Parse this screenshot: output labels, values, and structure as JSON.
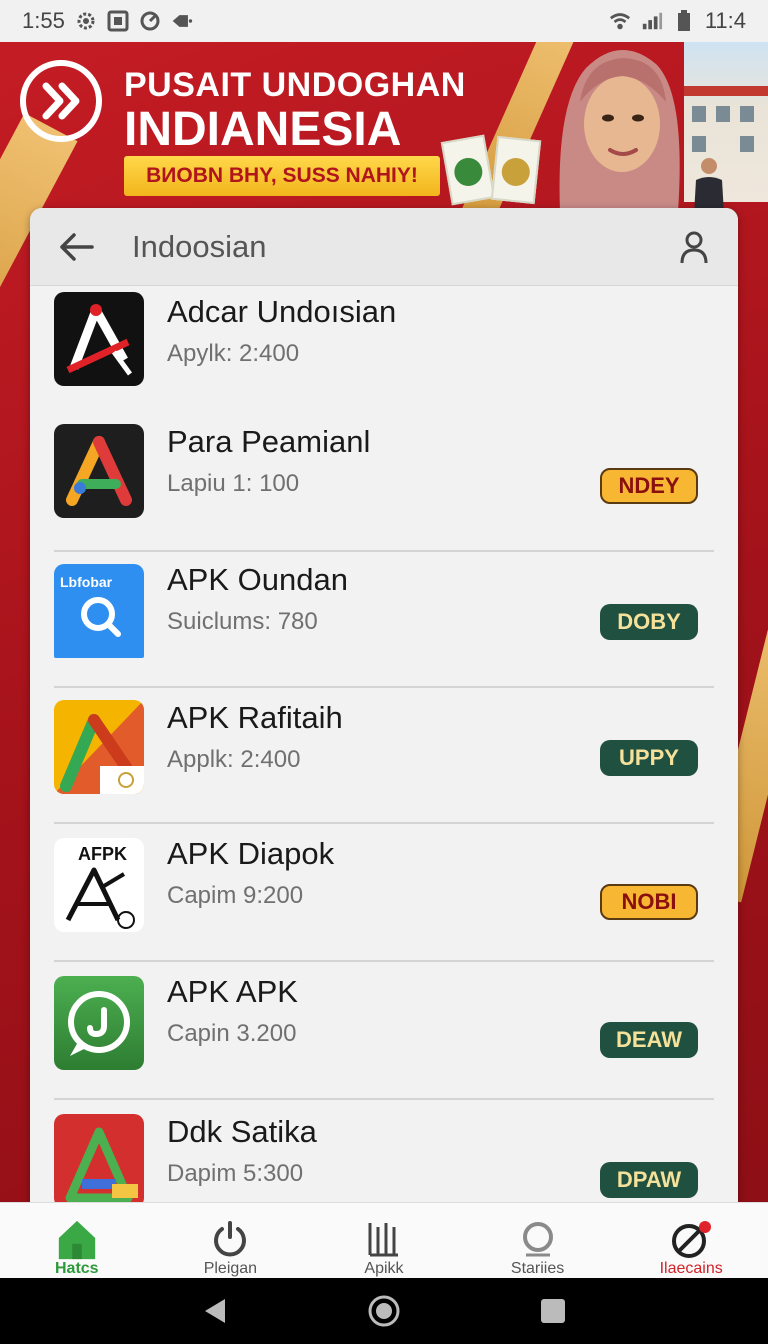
{
  "status_bar": {
    "time": "1:55",
    "battery_text": "11:4"
  },
  "banner": {
    "title_line1": "PUSAIT UNDOGHAN",
    "title_line2": "INDIANESIA",
    "subtitle": "BИOBN BHY, SUSS NAHIY!"
  },
  "search": {
    "query": "Indoosian"
  },
  "apps": [
    {
      "name": "Adcar Undoısian",
      "meta": "Apylk: 2:400",
      "badge": "",
      "badge_style": ""
    },
    {
      "name": "Para Peamianl",
      "meta": "Lapiu 1: 100",
      "badge": "NDEY",
      "badge_style": "yellow"
    },
    {
      "name": "APK Oundan",
      "meta": "Suiclums: 780",
      "badge": "DOBY",
      "badge_style": "green",
      "icon_text": "Lbfobar"
    },
    {
      "name": "APK Rafitaih",
      "meta": "Applk: 2:400",
      "badge": "UPPY",
      "badge_style": "green"
    },
    {
      "name": "APK Diapok",
      "meta": "Capim 9:200",
      "badge": "NOBI",
      "badge_style": "yellow",
      "icon_text": "AFPK"
    },
    {
      "name": "APK APK",
      "meta": "Capin 3.200",
      "badge": "DEAW",
      "badge_style": "green"
    },
    {
      "name": "Ddk Satika",
      "meta": "Dapim 5:300",
      "badge": "DPAW",
      "badge_style": "green"
    }
  ],
  "bottom_nav": [
    {
      "label": "Hatcs",
      "icon": "home-icon",
      "state": "active"
    },
    {
      "label": "Pleigan",
      "icon": "power-icon",
      "state": ""
    },
    {
      "label": "Apikk",
      "icon": "bars-icon",
      "state": ""
    },
    {
      "label": "Stariies",
      "icon": "search-icon",
      "state": ""
    },
    {
      "label": "Ilaecains",
      "icon": "compass-icon",
      "state": "alert"
    }
  ],
  "colors": {
    "primary_red": "#b0141c",
    "badge_yellow": "#f7b733",
    "badge_green": "#1f5040",
    "active_green": "#2c9a3a"
  }
}
